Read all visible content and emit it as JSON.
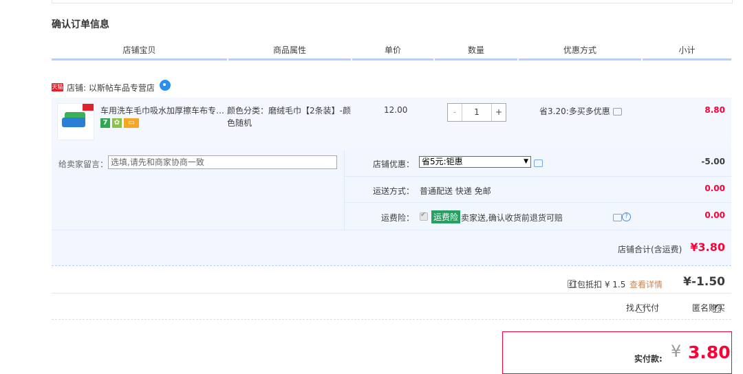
{
  "page_title": "确认订单信息",
  "columns": [
    "店铺宝贝",
    "商品属性",
    "单价",
    "数量",
    "优惠方式",
    "小计"
  ],
  "shop": {
    "badge": "天猫",
    "label": "店铺: 以斯帖车品专营店"
  },
  "item": {
    "name": "车用洗车毛巾吸水加厚擦车布专用...",
    "attribute": "颜色分类：磨绒毛巾【2条装】-颜色随机",
    "price": "12.00",
    "quantity": "1",
    "minus": "-",
    "plus": "+",
    "promo": "省3.20:多买多优惠",
    "subtotal": "8.80",
    "badges": [
      {
        "text": "7",
        "color": "#2fa84f"
      },
      {
        "text": "",
        "color": "#8bc34a"
      },
      {
        "text": "",
        "color": "#f5a623"
      }
    ]
  },
  "message": {
    "label": "给卖家留言：",
    "placeholder": "选填,请先和商家协商一致"
  },
  "shop_discount": {
    "label": "店铺优惠：",
    "selected": "省5元:钜惠",
    "amount": "-5.00"
  },
  "shipping": {
    "label": "运送方式：",
    "value": "普通配送 快递 免邮",
    "amount": "0.00"
  },
  "insurance": {
    "label": "运费险：",
    "tag": "运费险",
    "desc": "卖家送,确认收货前退货可赔",
    "amount": "0.00"
  },
  "shop_total": {
    "label": "店铺合计(含运费)",
    "amount": "¥3.80"
  },
  "red_packet": {
    "label": "红包抵扣 ¥ 1.5",
    "link": "查看详情",
    "amount": "¥-1.50"
  },
  "options": {
    "proxy_pay": "找人代付",
    "anonymous": "匿名购买",
    "anonymous_checked": true
  },
  "final": {
    "label": "实付款:",
    "currency": "¥",
    "amount": "3.80"
  },
  "colors": {
    "accent_red": "#ff0036",
    "header_line": "#b2d1ff",
    "panel_bg": "#f2f7ff"
  }
}
